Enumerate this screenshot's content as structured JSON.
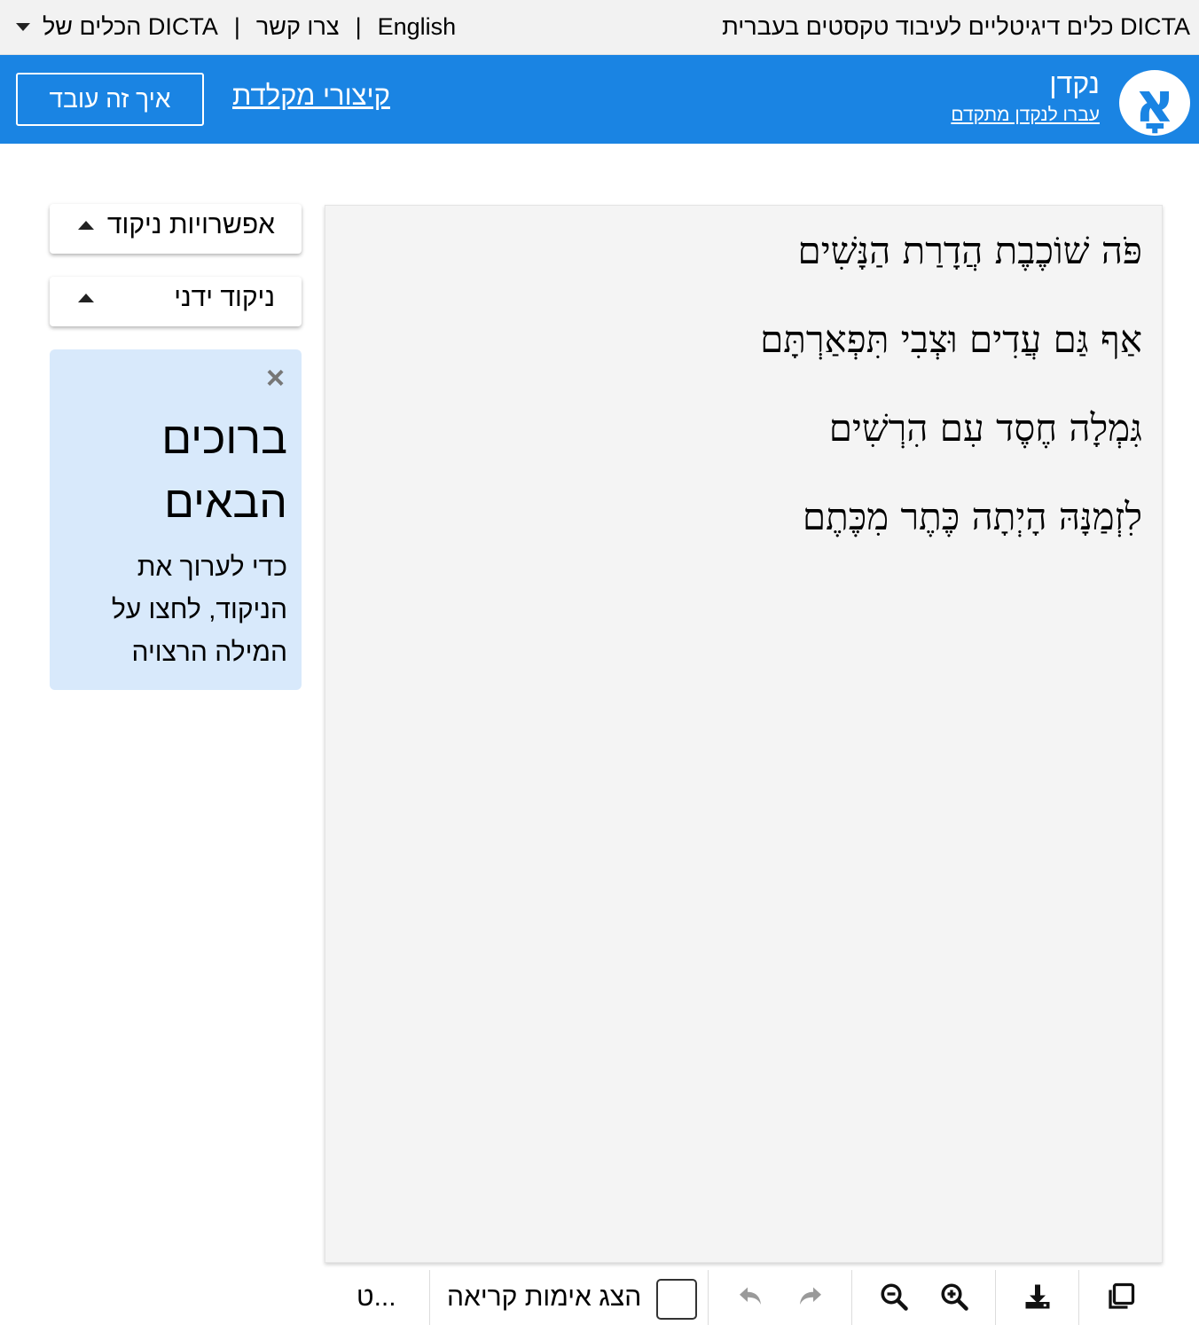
{
  "topbar": {
    "brand": "DICTA כלים דיגיטליים לעיבוד טקסטים בעברית",
    "english": "English",
    "separator": "|",
    "contact": "צרו קשר",
    "tools": "הכלים של DICTA"
  },
  "header": {
    "logo_glyph": "אָ",
    "title": "נקדן",
    "advanced_link": "עברו לנקדן מתקדם",
    "shortcuts_link": "קיצורי מקלדת",
    "how_button": "איך זה עובד"
  },
  "sidebar": {
    "options_button": "אפשרויות ניקוד",
    "manual_button": "ניקוד ידני",
    "welcome": {
      "close": "×",
      "title_line1": "ברוכים",
      "title_line2": "הבאים",
      "body": "כדי לערוך את הניקוד, לחצו על המילה הרצויה"
    }
  },
  "editor": {
    "lines": [
      "פֹּה שׁוֹכֶבֶת הֲדָרַת הַנָּשִׁים",
      "אַף גַּם עֲדִים וּצְבִי תִּפְאַרְתָּם",
      "גִּמְלָה חֶסֶד עִם הִרְשִׁים",
      "לִזְמַנָּהּ הָיְתָה כֶּתֶר מִכֶּתֶם"
    ]
  },
  "toolbar": {
    "truncated_label": "ט...",
    "show_reading_marks": "הצג אימות קריאה",
    "show_reading_marks_checked": false,
    "icons": [
      "undo-icon",
      "redo-icon",
      "zoom-out-icon",
      "zoom-in-icon",
      "download-icon",
      "copy-icon"
    ]
  },
  "colors": {
    "header_blue": "#1a84e3",
    "topbar_gray": "#f2f2f2",
    "welcome_bg": "#d8e9fb",
    "editor_bg": "#f4f4f4",
    "disabled_icon": "#9a9a9a"
  }
}
